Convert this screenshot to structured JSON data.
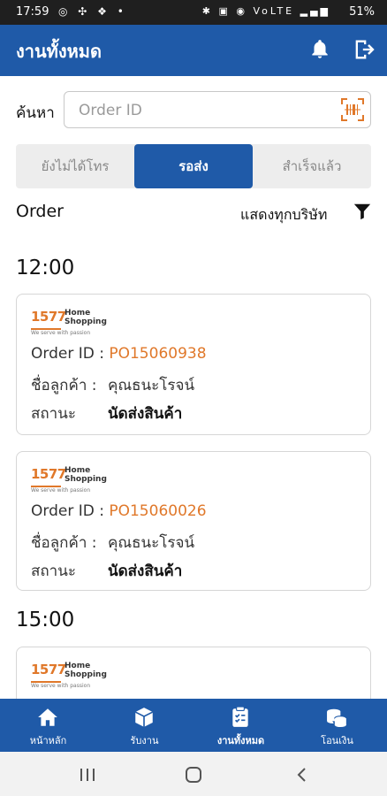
{
  "status_bar": {
    "time": "17:59",
    "battery": "51%",
    "signal_text": "VoLTE"
  },
  "header": {
    "title": "งานทั้งหมด"
  },
  "search": {
    "label": "ค้นหา",
    "placeholder": "Order ID"
  },
  "tabs": [
    {
      "label": "ยังไม่ได้โทร"
    },
    {
      "label": "รอส่ง",
      "active": true
    },
    {
      "label": "สำเร็จแล้ว"
    }
  ],
  "orders_header": {
    "title": "Order",
    "filter_label": "แสดงทุกบริษัท"
  },
  "groups": [
    {
      "time": "12:00",
      "cards": [
        {
          "logo_number": "1577",
          "logo_brand_line1": "Home",
          "logo_brand_line2": "Shopping",
          "logo_tagline": "We serve with passion",
          "order_label": "Order ID :",
          "order_id": "PO15060938",
          "customer_label": "ชื่อลูกค้า :",
          "customer_name": "คุณธนะโรจน์",
          "status_label": "สถานะ",
          "status_value": "นัดส่งสินค้า"
        },
        {
          "logo_number": "1577",
          "logo_brand_line1": "Home",
          "logo_brand_line2": "Shopping",
          "logo_tagline": "We serve with passion",
          "order_label": "Order ID :",
          "order_id": "PO15060026",
          "customer_label": "ชื่อลูกค้า :",
          "customer_name": "คุณธนะโรจน์",
          "status_label": "สถานะ",
          "status_value": "นัดส่งสินค้า"
        }
      ]
    },
    {
      "time": "15:00",
      "cards": [
        {
          "logo_number": "1577",
          "logo_brand_line1": "Home",
          "logo_brand_line2": "Shopping",
          "logo_tagline": "We serve with passion"
        }
      ]
    }
  ],
  "bottom_nav": [
    {
      "label": "หน้าหลัก",
      "icon": "home-icon"
    },
    {
      "label": "รับงาน",
      "icon": "box-icon"
    },
    {
      "label": "งานทั้งหมด",
      "icon": "clipboard-icon",
      "active": true
    },
    {
      "label": "โอนเงิน",
      "icon": "coins-icon"
    }
  ],
  "colors": {
    "primary": "#1f5aa8",
    "accent": "#e0782a"
  }
}
